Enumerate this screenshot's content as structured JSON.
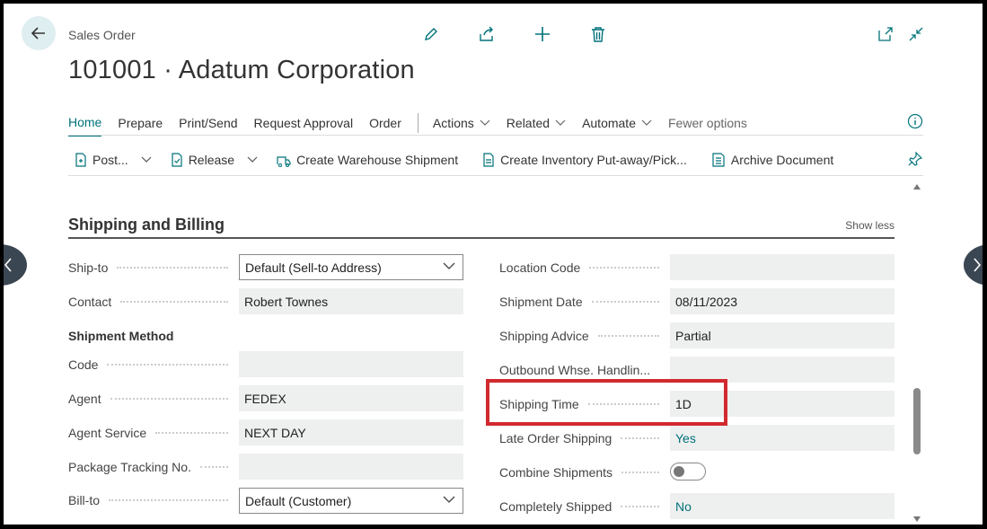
{
  "header": {
    "breadcrumb": "Sales Order",
    "title": "101001 · Adatum Corporation"
  },
  "tabs": [
    {
      "label": "Home",
      "active": true
    },
    {
      "label": "Prepare"
    },
    {
      "label": "Print/Send"
    },
    {
      "label": "Request Approval"
    },
    {
      "label": "Order"
    },
    {
      "label": "Actions"
    },
    {
      "label": "Related"
    },
    {
      "label": "Automate"
    },
    {
      "label": "Fewer options"
    }
  ],
  "toolbar": {
    "post": "Post...",
    "release": "Release",
    "create_warehouse_shipment": "Create Warehouse Shipment",
    "create_inventory": "Create Inventory Put-away/Pick...",
    "archive": "Archive Document"
  },
  "section": {
    "title": "Shipping and Billing",
    "toggle_label": "Show less"
  },
  "left_fields": {
    "ship_to": {
      "label": "Ship-to",
      "value": "Default (Sell-to Address)"
    },
    "contact": {
      "label": "Contact",
      "value": "Robert Townes"
    },
    "shipment_method_group": "Shipment Method",
    "code": {
      "label": "Code",
      "value": ""
    },
    "agent": {
      "label": "Agent",
      "value": "FEDEX"
    },
    "agent_service": {
      "label": "Agent Service",
      "value": "NEXT DAY"
    },
    "package_tracking": {
      "label": "Package Tracking No.",
      "value": ""
    },
    "bill_to": {
      "label": "Bill-to",
      "value": "Default (Customer)"
    }
  },
  "right_fields": {
    "location_code": {
      "label": "Location Code",
      "value": ""
    },
    "shipment_date": {
      "label": "Shipment Date",
      "value": "08/11/2023"
    },
    "shipping_advice": {
      "label": "Shipping Advice",
      "value": "Partial"
    },
    "outbound_whse": {
      "label": "Outbound Whse. Handlin...",
      "value": ""
    },
    "shipping_time": {
      "label": "Shipping Time",
      "value": "1D"
    },
    "late_order_shipping": {
      "label": "Late Order Shipping",
      "value": "Yes"
    },
    "combine_shipments": {
      "label": "Combine Shipments",
      "value": false
    },
    "completely_shipped": {
      "label": "Completely Shipped",
      "value": "No"
    }
  },
  "colors": {
    "accent": "#00727a",
    "highlight": "#d12a2f"
  }
}
